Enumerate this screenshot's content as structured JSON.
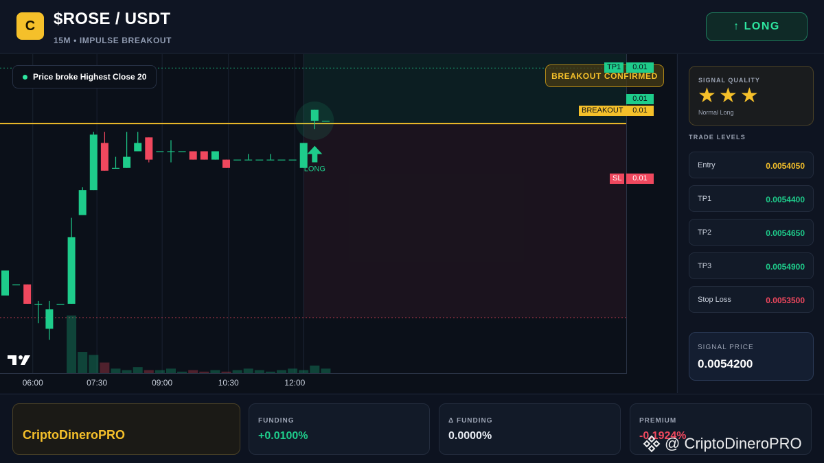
{
  "header": {
    "logo_letter": "C",
    "pair": "$ROSE / USDT",
    "subtitle": "15M • IMPULSE BREAKOUT",
    "direction_button": "↑ LONG"
  },
  "chart": {
    "signal_note": "Price broke Highest Close 20",
    "badge": "BREAKOUT CONFIRMED",
    "arrow_label": "LONG",
    "price_tags": {
      "tp1_label": "TP1",
      "tp1_value": "0.01",
      "current_value": "0.01",
      "breakout_label": "BREAKOUT",
      "breakout_value": "0.01",
      "sl_label": "SL",
      "sl_value": "0.01"
    },
    "colors": {
      "up": "#1ecc8b",
      "down": "#f0485e",
      "breakout": "#f5c02a"
    }
  },
  "chart_data": {
    "type": "candlestick",
    "title": "",
    "xlabel": "",
    "ylabel": "",
    "x_ticks": [
      "06:00",
      "07:30",
      "09:00",
      "10:30",
      "12:00"
    ],
    "candles": [
      {
        "o": 0.005358,
        "h": 0.005358,
        "c": 0.005367
      },
      {
        "o": 0.005362,
        "h": 0.005362,
        "c": 0.005362
      },
      {
        "o": 0.005362,
        "h": 0.005362,
        "c": 0.005355
      },
      {
        "o": 0.005355,
        "h": 0.005356,
        "l": 0.005348,
        "c": 0.005355
      },
      {
        "o": 0.005346,
        "h": 0.005356,
        "l": 0.005342,
        "c": 0.005353
      },
      {
        "o": 0.005355,
        "h": 0.005355,
        "c": 0.005355
      },
      {
        "o": 0.005355,
        "h": 0.005386,
        "l": 0.005355,
        "c": 0.005379
      },
      {
        "o": 0.005387,
        "h": 0.005397,
        "l": 0.005387,
        "c": 0.005396
      },
      {
        "o": 0.005396,
        "h": 0.005417,
        "l": 0.005396,
        "c": 0.005416
      },
      {
        "o": 0.005413,
        "h": 0.005417,
        "l": 0.005403,
        "c": 0.005403
      },
      {
        "o": 0.005404,
        "h": 0.005408,
        "l": 0.005404,
        "c": 0.005404
      },
      {
        "o": 0.005404,
        "h": 0.005417,
        "l": 0.005404,
        "c": 0.005408
      },
      {
        "o": 0.00541,
        "h": 0.005417,
        "l": 0.00541,
        "c": 0.005413
      },
      {
        "o": 0.005415,
        "h": 0.005415,
        "l": 0.005406,
        "c": 0.005407
      },
      {
        "o": 0.00541,
        "h": 0.00541,
        "c": 0.00541
      },
      {
        "o": 0.00541,
        "h": 0.005414,
        "l": 0.005406,
        "c": 0.00541
      },
      {
        "o": 0.00541,
        "h": 0.00541,
        "c": 0.00541
      },
      {
        "o": 0.00541,
        "h": 0.00541,
        "l": 0.005407,
        "c": 0.005407
      },
      {
        "o": 0.00541,
        "h": 0.00541,
        "l": 0.005407,
        "c": 0.005407
      },
      {
        "o": 0.005407,
        "h": 0.00541,
        "l": 0.005407,
        "c": 0.00541
      },
      {
        "o": 0.005407,
        "h": 0.005407,
        "l": 0.005404,
        "c": 0.005404
      },
      {
        "o": 0.005407,
        "h": 0.005407,
        "c": 0.005407
      },
      {
        "o": 0.005407,
        "h": 0.005409,
        "l": 0.005407,
        "c": 0.005407
      },
      {
        "o": 0.005407,
        "h": 0.005407,
        "c": 0.005407
      },
      {
        "o": 0.005407,
        "h": 0.005409,
        "l": 0.005407,
        "c": 0.005407
      },
      {
        "o": 0.005407,
        "h": 0.005407,
        "c": 0.005407
      },
      {
        "o": 0.005407,
        "h": 0.005407,
        "c": 0.005407
      },
      {
        "o": 0.005404,
        "h": 0.005413,
        "l": 0.005404,
        "c": 0.005413
      },
      {
        "o": 0.005421,
        "h": 0.005425,
        "l": 0.005418,
        "c": 0.005425
      },
      {
        "o": 0.005421,
        "h": 0.005421,
        "c": 0.005421
      }
    ],
    "volumes": [
      0,
      0,
      0,
      0,
      0,
      0,
      38,
      14,
      12,
      7,
      3,
      2,
      4,
      2,
      2,
      3,
      1,
      2,
      1,
      2,
      1,
      2,
      3,
      2,
      1,
      2,
      3,
      2,
      5,
      3
    ],
    "levels": {
      "tp1": 0.00544,
      "breakout": 0.00542,
      "sl": 0.00535
    },
    "ylim": [
      0.00533,
      0.005445
    ],
    "grid": true
  },
  "panel": {
    "quality_title": "SIGNAL QUALITY",
    "stars": "★★★",
    "quality_sub": "Normal Long",
    "levels_title": "TRADE LEVELS",
    "levels": [
      {
        "name": "Entry",
        "value": "0.0054050",
        "color": "#f5c02a"
      },
      {
        "name": "TP1",
        "value": "0.0054400",
        "color": "#1ecc8b"
      },
      {
        "name": "TP2",
        "value": "0.0054650",
        "color": "#1ecc8b"
      },
      {
        "name": "TP3",
        "value": "0.0054900",
        "color": "#1ecc8b"
      },
      {
        "name": "Stop Loss",
        "value": "0.0053500",
        "color": "#f0485e"
      }
    ],
    "signal_price_title": "SIGNAL PRICE",
    "signal_price": "0.0054200"
  },
  "footer": {
    "brand": "CriptoDineroPRO",
    "funding_title": "FUNDING",
    "funding_value": "+0.0100%",
    "dfunding_title": "Δ FUNDING",
    "dfunding_value": "0.0000%",
    "premium_title": "PREMIUM",
    "premium_value": "-0.1924%",
    "watermark": "@ CriptoDineroPRO"
  }
}
